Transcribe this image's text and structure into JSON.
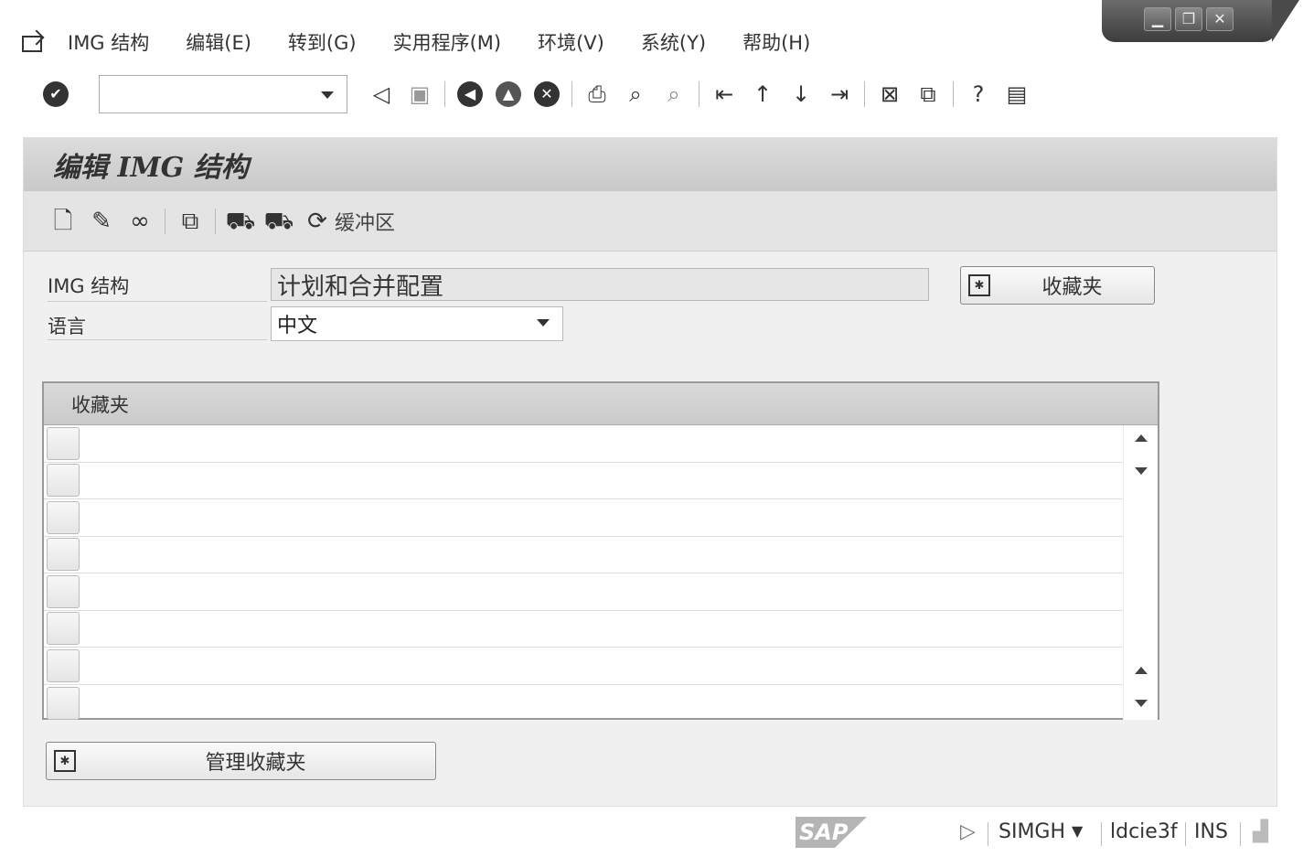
{
  "window": {
    "minimize_glyph": "▁",
    "restore_glyph": "❐",
    "close_glyph": "✕"
  },
  "menu": {
    "items": [
      "IMG 结构",
      "编辑(E)",
      "转到(G)",
      "实用程序(M)",
      "环境(V)",
      "系统(Y)",
      "帮助(H)"
    ]
  },
  "toolbar": {
    "command_value": ""
  },
  "panel": {
    "title": "编辑 IMG 结构",
    "buffer_label": "缓冲区"
  },
  "form": {
    "img_structure_label": "IMG 结构",
    "img_structure_value": "计划和合并配置",
    "language_label": "语言",
    "language_value": "中文",
    "favorites_button": "收藏夹"
  },
  "table": {
    "header": "收藏夹",
    "rows": [
      "",
      "",
      "",
      "",
      "",
      "",
      "",
      ""
    ]
  },
  "manage_button": "管理收藏夹",
  "status": {
    "logo": "SAP",
    "system": "SIMGH",
    "server": "ldcie3f",
    "mode": "INS"
  }
}
